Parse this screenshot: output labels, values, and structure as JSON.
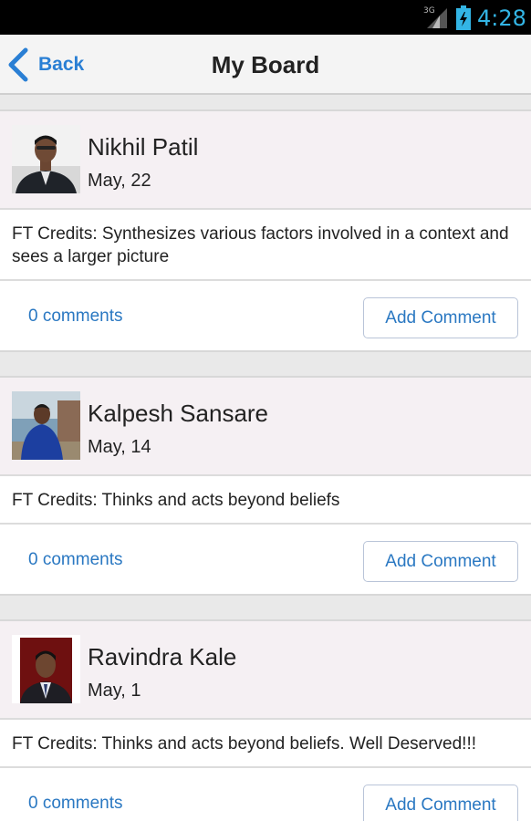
{
  "status_bar": {
    "network": "3G",
    "time": "4:28",
    "accent_color": "#33b5e5"
  },
  "nav": {
    "back_label": "Back",
    "title": "My Board",
    "link_color": "#2a7fd4"
  },
  "posts": [
    {
      "name": "Nikhil Patil",
      "date": "May, 22",
      "text": "FT Credits: Synthesizes various factors involved in a context and sees a larger picture",
      "comments_label": "0 comments",
      "add_comment_label": "Add Comment"
    },
    {
      "name": "Kalpesh Sansare",
      "date": "May, 14",
      "text": "FT Credits: Thinks and acts beyond beliefs",
      "comments_label": "0 comments",
      "add_comment_label": "Add Comment"
    },
    {
      "name": "Ravindra Kale",
      "date": "May, 1",
      "text": "FT Credits: Thinks and acts beyond beliefs. Well Deserved!!!",
      "comments_label": "0 comments",
      "add_comment_label": "Add Comment"
    }
  ]
}
